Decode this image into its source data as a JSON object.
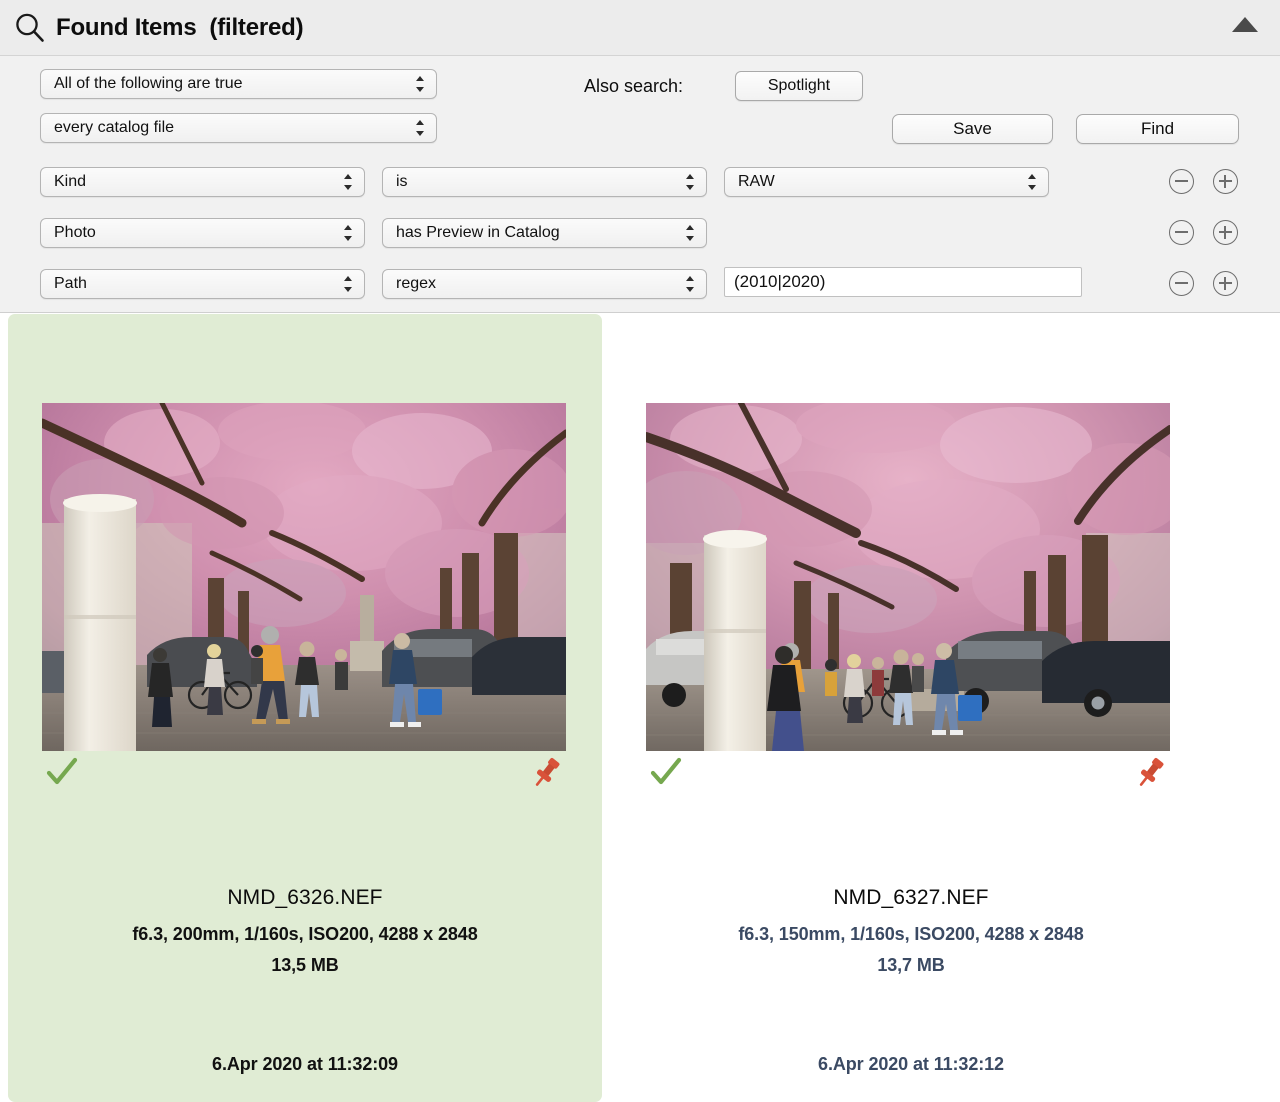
{
  "window": {
    "title": "Found Items  (filtered)",
    "search_icon": "magnifier-icon",
    "collapse_icon": "triangle-up-icon"
  },
  "filter": {
    "match_rule": "All of the following are true",
    "scope": "every catalog file",
    "also_search_label": "Also search:",
    "spotlight_button": "Spotlight",
    "save_button": "Save",
    "find_button": "Find",
    "rows": [
      {
        "field": "Kind",
        "operator": "is",
        "value_popup": "RAW",
        "value_text": null,
        "minus_label": "remove-criterion",
        "plus_label": "add-criterion"
      },
      {
        "field": "Photo",
        "operator": "has Preview in Catalog",
        "value_popup": null,
        "value_text": null,
        "minus_label": "remove-criterion",
        "plus_label": "add-criterion"
      },
      {
        "field": "Path",
        "operator": "regex",
        "value_popup": null,
        "value_text": "(2010|2020)",
        "minus_label": "remove-criterion",
        "plus_label": "add-criterion"
      }
    ]
  },
  "results": {
    "items": [
      {
        "filename": "NMD_6326.NEF",
        "exif": "f6.3, 200mm, 1/160s, ISO200, 4288 x 2848",
        "filesize": "13,5 MB",
        "date": "6.Apr 2020 at 11:32:09",
        "selected": true,
        "text_color": "#111111",
        "check_icon": "checkmark-icon",
        "pin_icon": "pushpin-icon"
      },
      {
        "filename": "NMD_6327.NEF",
        "exif": "f6.3, 150mm, 1/160s, ISO200, 4288 x 2848",
        "filesize": "13,7 MB",
        "date": "6.Apr 2020 at 11:32:12",
        "selected": false,
        "text_color": "#3b4a63",
        "check_icon": "checkmark-icon",
        "pin_icon": "pushpin-icon"
      }
    ]
  },
  "colors": {
    "selection_green": "#e0ecd4",
    "check_green": "#76a84f",
    "pin_red": "#d9523a",
    "panel_gray": "#f1f1f1",
    "titlebar_gray": "#ececec"
  }
}
